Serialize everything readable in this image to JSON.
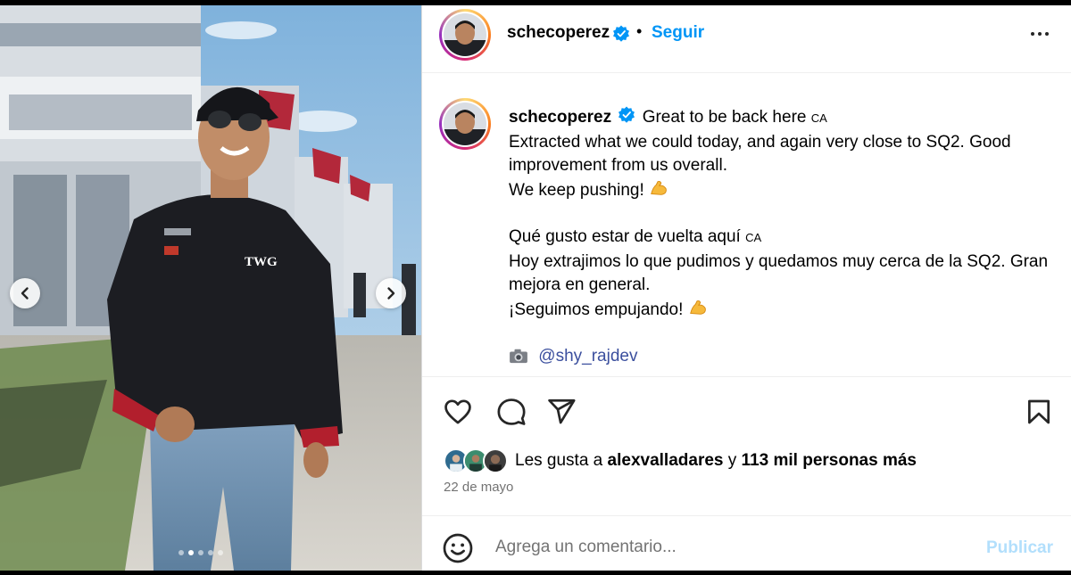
{
  "post": {
    "username": "schecoperez",
    "follow_label": "Seguir",
    "separator": "•",
    "caption": {
      "line1": "Great to be back here",
      "flag1": "CA",
      "line2": "Extracted what we could today, and again very close to SQ2. Good improvement from us overall.",
      "line3": "We keep pushing!",
      "line4": "Qué gusto estar de vuelta aquí",
      "flag2": "CA",
      "line5": "Hoy extrajimos lo que pudimos y quedamos muy cerca de la SQ2. Gran mejora en general.",
      "line6": "¡Seguimos empujando!",
      "credit_mention": "@shy_rajdev"
    },
    "likes": {
      "prefix": "Les gusta a",
      "user": "alexvalladares",
      "joiner": "y",
      "others": "113 mil personas más"
    },
    "date": "22 de mayo",
    "comment": {
      "placeholder": "Agrega un comentario...",
      "publish_label": "Publicar"
    },
    "carousel": {
      "slide_count": 5,
      "active_slide": 2
    }
  },
  "colors": {
    "accent": "#0095f6",
    "publish_disabled": "#b2dffc",
    "secondary_text": "#737373",
    "verified": "#0095f6"
  },
  "icons": [
    "chevron-left-icon",
    "chevron-right-icon",
    "verified-badge-icon",
    "more-options-icon",
    "heart-icon",
    "comment-icon",
    "share-icon",
    "bookmark-icon",
    "emoji-icon",
    "camera-icon",
    "flexed-biceps-icon"
  ]
}
